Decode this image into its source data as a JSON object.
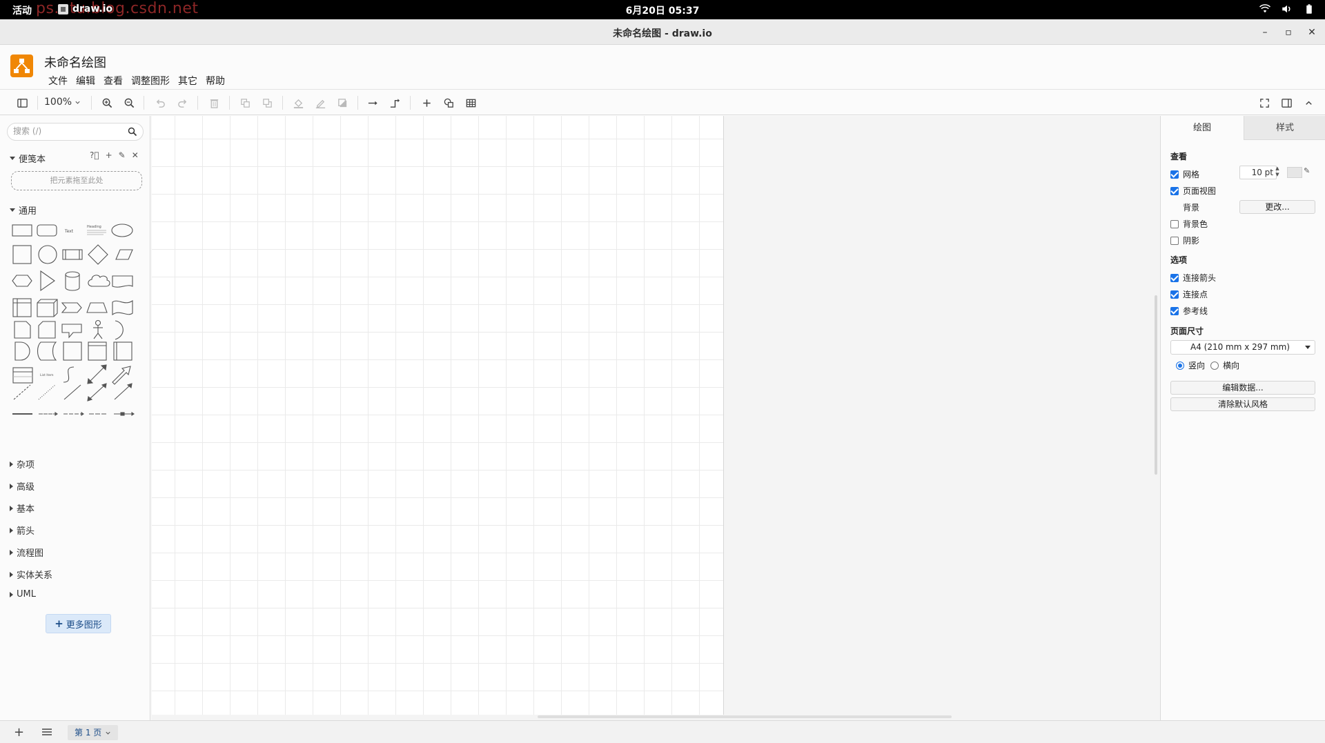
{
  "system_bar": {
    "activities": "活动",
    "app_name": "draw.io",
    "watermark": "ps...tu.blog.csdn.net",
    "clock": "6月20日 05:37"
  },
  "window": {
    "title": "未命名绘图 - draw.io",
    "minimize": "–",
    "maximize": "▫",
    "close": "✕"
  },
  "app": {
    "doc_title": "未命名绘图",
    "menu": [
      "文件",
      "编辑",
      "查看",
      "调整图形",
      "其它",
      "帮助"
    ],
    "brand_color": "#f08705"
  },
  "toolbar": {
    "zoom": "100%"
  },
  "sidebar": {
    "search_placeholder": "搜索 (/)",
    "scratchpad_title": "便笺本",
    "dropzone_text": "把元素拖至此处",
    "general_title": "通用",
    "shape_texts": {
      "text": "Text",
      "heading": "Heading",
      "list_item": "List Item"
    },
    "collapsed_sections": [
      "杂项",
      "高级",
      "基本",
      "箭头",
      "流程图",
      "实体关系",
      "UML"
    ],
    "more_shapes": "更多图形"
  },
  "format_panel": {
    "tabs": [
      "绘图",
      "样式"
    ],
    "view_title": "查看",
    "grid_label": "网格",
    "grid_checked": true,
    "grid_size": "10 pt",
    "page_view_label": "页面视图",
    "page_view_checked": true,
    "background_label": "背景",
    "background_button": "更改...",
    "bg_color_label": "背景色",
    "bg_color_checked": false,
    "shadow_label": "阴影",
    "shadow_checked": false,
    "options_title": "选项",
    "connection_arrows_label": "连接箭头",
    "connection_points_label": "连接点",
    "guides_label": "参考线",
    "page_size_title": "页面尺寸",
    "page_size_value": "A4 (210 mm x 297 mm)",
    "portrait_label": "竖向",
    "landscape_label": "横向",
    "orientation": "portrait",
    "edit_data_button": "编辑数据...",
    "clear_style_button": "清除默认风格",
    "accent_color": "#1a73e8"
  },
  "footer": {
    "add_page": "+",
    "page_tab": "第 1 页"
  }
}
